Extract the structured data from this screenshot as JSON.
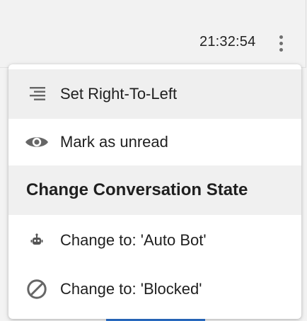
{
  "header": {
    "time": "21:32:54",
    "more_icon": "vertical-ellipsis-icon"
  },
  "menu": {
    "items": [
      {
        "label": "Set Right-To-Left",
        "icon": "align-right-icon"
      },
      {
        "label": "Mark as unread",
        "icon": "eye-icon"
      }
    ],
    "section": {
      "title": "Change Conversation State",
      "items": [
        {
          "label": "Change to: 'Auto Bot'",
          "icon": "robot-icon"
        },
        {
          "label": "Change to: 'Blocked'",
          "icon": "blocked-icon"
        }
      ]
    }
  },
  "colors": {
    "highlight": "#efefef",
    "accent_button": "#2d74d4",
    "icon_gray": "#666666"
  }
}
